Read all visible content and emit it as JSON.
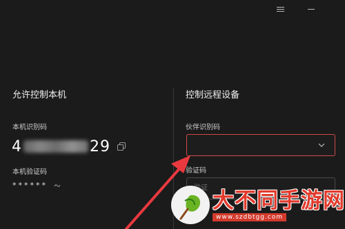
{
  "titlebar": {
    "menu_icon": "menu-icon",
    "minimize_icon": "minimize-icon"
  },
  "local": {
    "title": "允许控制本机",
    "id_label": "本机识别码",
    "id_prefix": "4",
    "id_suffix": "29",
    "code_label": "本机验证码",
    "code_mask": "******",
    "copy_icon": "copy-icon",
    "refresh_icon": "refresh-icon"
  },
  "remote": {
    "title": "控制远程设备",
    "partner_label": "伙伴识别码",
    "partner_value": "",
    "verify_label": "验证码",
    "verify_placeholder": "验证"
  },
  "watermark": {
    "title": "大不同手游网",
    "url": "www.szdbtgg.com"
  },
  "colors": {
    "background": "#1b1b1b",
    "input_border_active": "#d04a4a",
    "arrow": "#e8393f",
    "watermark_red": "#e23a2c"
  }
}
